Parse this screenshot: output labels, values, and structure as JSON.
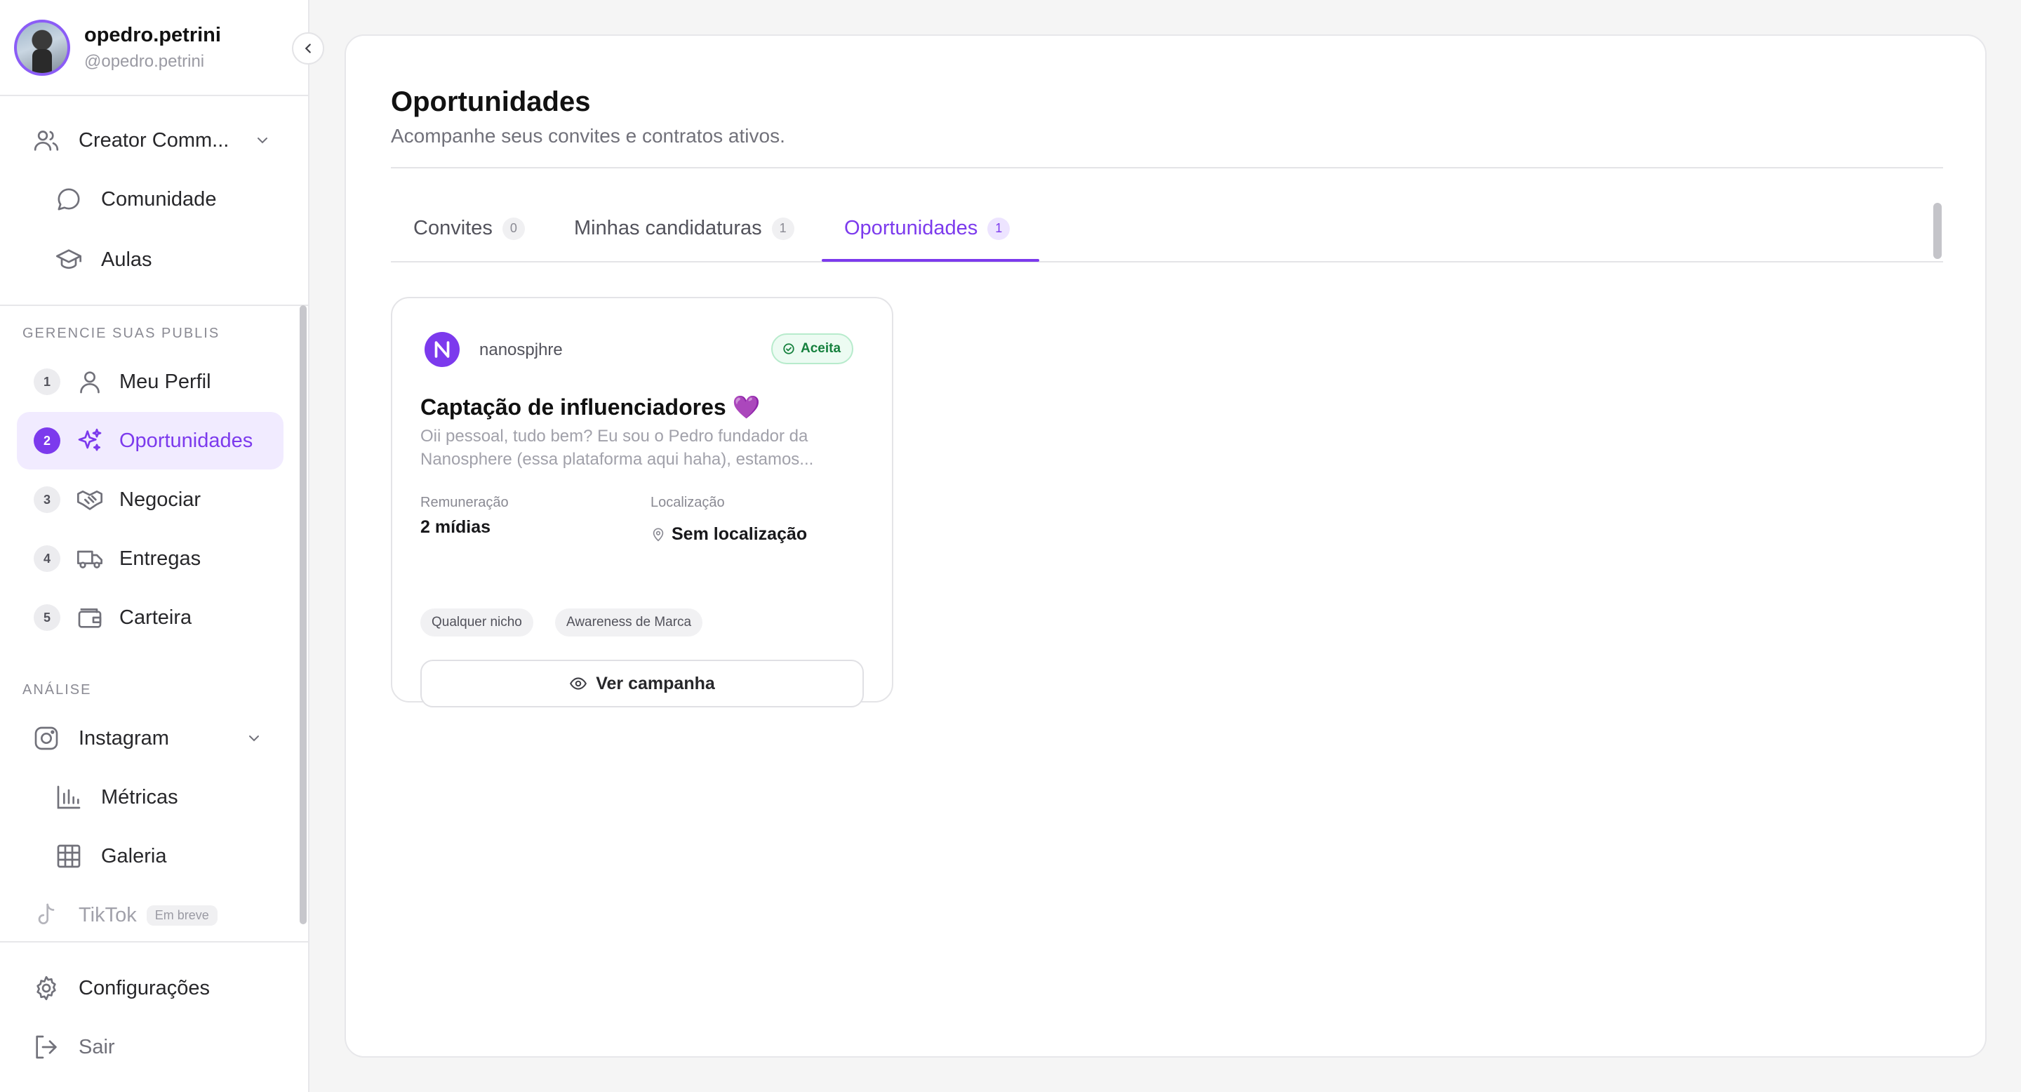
{
  "profile": {
    "name": "opedro.petrini",
    "handle": "@opedro.petrini"
  },
  "sidebar": {
    "community": {
      "label": "Creator Comm...",
      "items": [
        {
          "label": "Comunidade"
        },
        {
          "label": "Aulas"
        }
      ]
    },
    "manage_section": "GERENCIE SUAS PUBLIS",
    "steps": [
      {
        "number": "1",
        "label": "Meu Perfil"
      },
      {
        "number": "2",
        "label": "Oportunidades"
      },
      {
        "number": "3",
        "label": "Negociar"
      },
      {
        "number": "4",
        "label": "Entregas"
      },
      {
        "number": "5",
        "label": "Carteira"
      }
    ],
    "analysis_section": "ANÁLISE",
    "instagram": {
      "label": "Instagram",
      "items": [
        {
          "label": "Métricas"
        },
        {
          "label": "Galeria"
        }
      ]
    },
    "tiktok": {
      "label": "TikTok",
      "badge": "Em breve"
    },
    "settings": "Configurações",
    "logout": "Sair"
  },
  "main": {
    "title": "Oportunidades",
    "subtitle": "Acompanhe seus convites e contratos ativos.",
    "tabs": [
      {
        "label": "Convites",
        "count": "0"
      },
      {
        "label": "Minhas candidaturas",
        "count": "1"
      },
      {
        "label": "Oportunidades",
        "count": "1"
      }
    ],
    "active_tab": "Oportunidades"
  },
  "card": {
    "brand": "nanospjhre",
    "status": "Aceita",
    "title": "Captação de influenciadores 💜",
    "description": "Oii pessoal, tudo bem? Eu sou o Pedro fundador da Nanosphere (essa plataforma aqui haha), estamos...",
    "remuneration_label": "Remuneração",
    "remuneration_value": "2 mídias",
    "location_label": "Localização",
    "location_value": "Sem localização",
    "tags": [
      "Qualquer nicho",
      "Awareness de Marca"
    ],
    "cta": "Ver campanha"
  },
  "colors": {
    "accent": "#7c3aed",
    "accent_soft": "#f1ebff",
    "success": "#15803d"
  }
}
